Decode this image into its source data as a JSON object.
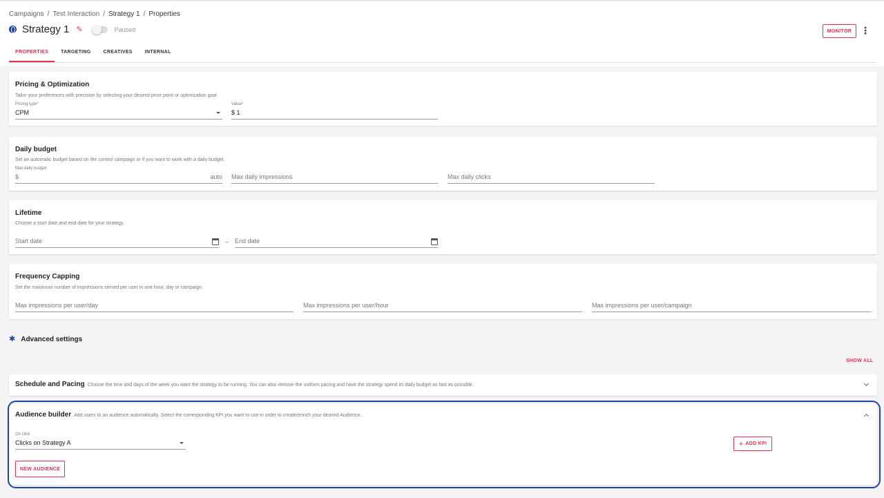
{
  "breadcrumb": {
    "items": [
      "Campaigns",
      "Test Interaction",
      "Strategy 1",
      "Properties"
    ],
    "separator": "/"
  },
  "header": {
    "title": "Strategy 1",
    "status": "Paused",
    "monitor_label": "MONITOR",
    "more_glyph": "⋮"
  },
  "tabs": [
    "PROPERTIES",
    "TARGETING",
    "CREATIVES",
    "INTERNAL"
  ],
  "pricing": {
    "title": "Pricing & Optimization",
    "desc": "Tailor your preferences with precision by selecting your desired price point or optimization goal",
    "type_label": "Pricing type*",
    "type_value": "CPM",
    "value_label": "Value*",
    "value_value": "$ 1"
  },
  "budget": {
    "title": "Daily budget",
    "desc": "Set an automatic budget based on the control campaign or if you want to work with a daily budget.",
    "max_budget_label": "Max daily budget",
    "currency": "$",
    "auto": "auto",
    "impressions_placeholder": "Max daily impressions",
    "clicks_placeholder": "Max daily clicks"
  },
  "lifetime": {
    "title": "Lifetime",
    "desc": "Choose a start date and end date for your strategy.",
    "start_placeholder": "Start date",
    "range_dash": "–",
    "end_placeholder": "End date"
  },
  "frequency": {
    "title": "Frequency Capping",
    "desc": "Set the maximum number of impressions served per user in one hour, day or campaign.",
    "day_placeholder": "Max impressions per user/day",
    "hour_placeholder": "Max impressions per user/hour",
    "campaign_placeholder": "Max impressions per user/campaign"
  },
  "advanced": {
    "title": "Advanced settings",
    "show_all": "SHOW ALL"
  },
  "schedule": {
    "title": "Schedule and Pacing",
    "desc": "Choose the time and days of the week you want the strategy to be running. You can also remove the uniform pacing and have the strategy spend its daily budget as fast as possible."
  },
  "audience": {
    "title": "Audience builder",
    "desc": "Add users to an audience automatically. Select the corresponding KPI you want to use in order to create/enrich your desired Audience.",
    "on_click_label": "On click",
    "on_click_value": "Clicks on Strategy A",
    "add_kpi_label": "ADD KPI",
    "new_audience_label": "NEW AUDIENCE"
  },
  "colors": {
    "accent": "#e62e4d",
    "brand_blue": "#1a44a6",
    "background": "#f4f4f4"
  },
  "icons": {
    "globe": "globe-icon",
    "edit": "pencil-icon",
    "gear": "gear-icon",
    "calendar": "calendar-icon",
    "more": "more-vertical-icon"
  }
}
